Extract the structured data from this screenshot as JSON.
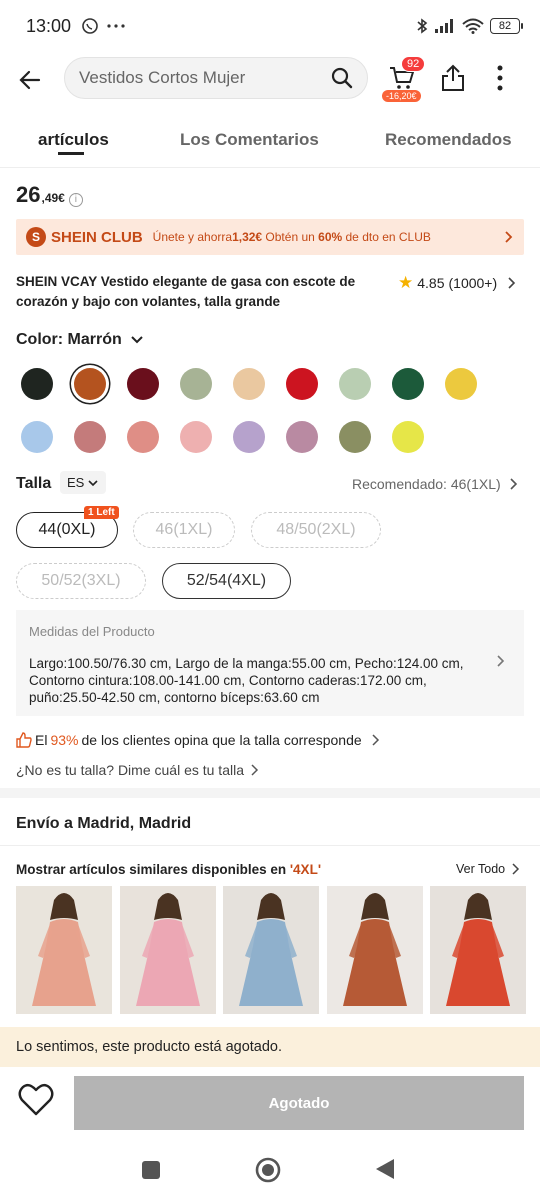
{
  "status": {
    "time": "13:00",
    "battery": "82"
  },
  "header": {
    "search_text": "Vestidos Cortos Mujer",
    "cart_count": "92",
    "cart_discount": "-16,20€"
  },
  "tabs": [
    {
      "label": "artículos"
    },
    {
      "label": "Los Comentarios"
    },
    {
      "label": "Recomendados"
    }
  ],
  "price": {
    "main": "26",
    "decimals": ",49€"
  },
  "club": {
    "name": "SHEIN CLUB",
    "text_before": "Únete y ahorra",
    "amount": "1,32€",
    "text_mid": " Obtén un ",
    "percent": "60%",
    "text_after": " de dto en CLUB"
  },
  "product": {
    "title": "SHEIN VCAY Vestido elegante de gasa con escote de corazón y bajo con volantes, talla grande",
    "rating": "4.85",
    "reviews": "(1000+)"
  },
  "color": {
    "label": "Color: Marrón",
    "swatches": [
      "#1f2520",
      "#b4531f",
      "#6a0f1c",
      "#a7b395",
      "#eac8a0",
      "#cc1420",
      "#b9ceb2",
      "#1c5a3a",
      "#ecc93e",
      "#a8c8ea",
      "#c47b7b",
      "#df8e86",
      "#eeb0b0",
      "#b6a2cc",
      "#b98aa2",
      "#8a8f62",
      "#e6e648"
    ],
    "selected_index": 1
  },
  "size": {
    "label": "Talla",
    "region": "ES",
    "recommended": "Recomendado: 46(1XL)",
    "options": [
      {
        "label": "44(0XL)",
        "state": "active"
      },
      {
        "label": "46(1XL)",
        "state": "disabled"
      },
      {
        "label": "48/50(2XL)",
        "state": "disabled"
      },
      {
        "label": "50/52(3XL)",
        "state": "disabled"
      },
      {
        "label": "52/54(4XL)",
        "state": "boxed"
      }
    ],
    "left_badge": "1 Left"
  },
  "measures": {
    "title": "Medidas del Producto",
    "items": [
      {
        "key": "Largo:",
        "value": "100.50/76.30 cm, "
      },
      {
        "key": "Largo de la manga:",
        "value": "55.00 cm, "
      },
      {
        "key": "Pecho:",
        "value": "124.00 cm, "
      },
      {
        "key": "Contorno cintura:",
        "value": "108.00-141.00 cm, "
      },
      {
        "key": "Contorno caderas:",
        "value": "172.00 cm, "
      },
      {
        "key": "puño:",
        "value": "25.50-42.50 cm, "
      },
      {
        "key": "contorno bíceps:",
        "value": "63.60 cm"
      }
    ]
  },
  "fit": {
    "prefix": "El ",
    "percent": "93%",
    "suffix": " de los clientes opina que la talla corresponde"
  },
  "advice": "¿No es tu talla? Dime cuál es tu talla",
  "shipping": "Envío a Madrid, Madrid",
  "similar": {
    "title_prefix": "Mostrar artículos similares disponibles en ",
    "size": "'4XL'",
    "view_all": "Ver Todo"
  },
  "out_of_stock": "Lo sentimos, este producto está agotado.",
  "sold_out_button": "Agotado",
  "thumbnails": [
    {
      "dress": "#e7a28d",
      "bg": "#e9e4dc"
    },
    {
      "dress": "#eca7b4",
      "bg": "#e8e2db"
    },
    {
      "dress": "#8fb0cc",
      "bg": "#e5e1dc"
    },
    {
      "dress": "#b65a36",
      "bg": "#ece8e4"
    },
    {
      "dress": "#d9482f",
      "bg": "#e6e1dc"
    }
  ]
}
